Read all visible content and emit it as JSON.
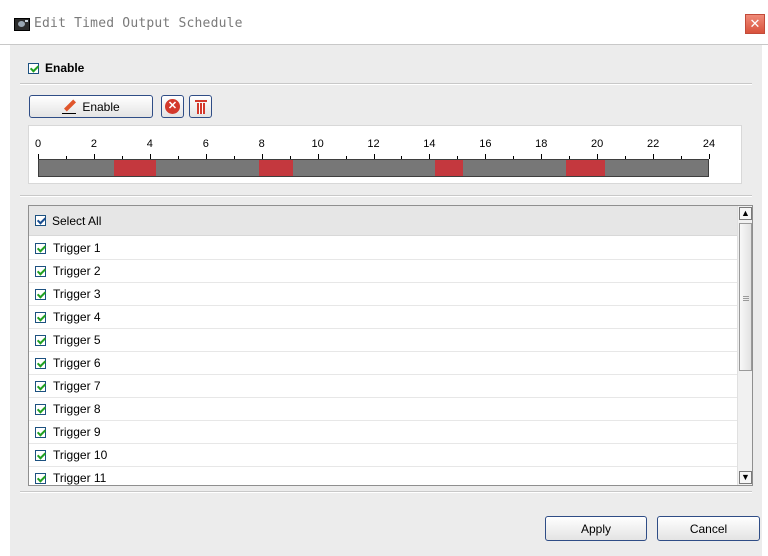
{
  "window": {
    "title": "Edit Timed Output Schedule",
    "close_glyph": "✕"
  },
  "enable_checkbox": {
    "label": "Enable",
    "checked": true
  },
  "toolbar": {
    "enable_label": "Enable",
    "clear_glyph": "✕"
  },
  "timeline": {
    "ticks": [
      "0",
      "2",
      "4",
      "6",
      "8",
      "10",
      "12",
      "14",
      "16",
      "18",
      "20",
      "22",
      "24"
    ],
    "range_hours": [
      0,
      24
    ],
    "bar_color": "#777777",
    "scheduled_color": "#c4383e",
    "scheduled_segments_hours": [
      [
        2.7,
        4.2
      ],
      [
        7.9,
        9.1
      ],
      [
        14.2,
        15.2
      ],
      [
        18.9,
        20.3
      ]
    ]
  },
  "trigger_list": {
    "select_all_label": "Select All",
    "items": [
      {
        "label": "Trigger 1",
        "checked": true
      },
      {
        "label": "Trigger 2",
        "checked": true
      },
      {
        "label": "Trigger 3",
        "checked": true
      },
      {
        "label": "Trigger 4",
        "checked": true
      },
      {
        "label": "Trigger 5",
        "checked": true
      },
      {
        "label": "Trigger 6",
        "checked": true
      },
      {
        "label": "Trigger 7",
        "checked": true
      },
      {
        "label": "Trigger 8",
        "checked": true
      },
      {
        "label": "Trigger 9",
        "checked": true
      },
      {
        "label": "Trigger 10",
        "checked": true
      },
      {
        "label": "Trigger 11",
        "checked": true
      }
    ]
  },
  "footer": {
    "apply_label": "Apply",
    "cancel_label": "Cancel"
  }
}
